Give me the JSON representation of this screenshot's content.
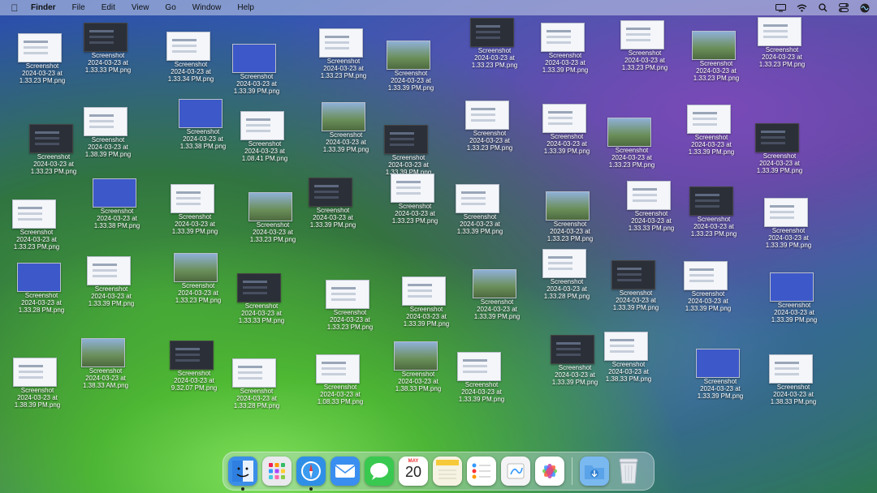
{
  "menubar": {
    "app_name": "Finder",
    "menus": [
      "File",
      "Edit",
      "View",
      "Go",
      "Window",
      "Help"
    ],
    "status_icons": [
      "display-icon",
      "wifi-icon",
      "search-icon",
      "control-center-icon",
      "siri-icon"
    ]
  },
  "desktop": {
    "files": [
      {
        "l1": "Screenshot",
        "l2": "2024-03-23 at",
        "l3": "1.33.23 PM.png"
      },
      {
        "l1": "Screenshot",
        "l2": "2024-03-23 at",
        "l3": "1.33.33 PM.png"
      },
      {
        "l1": "Screenshot",
        "l2": "2024-03-23 at",
        "l3": "1.33.34 PM.png"
      },
      {
        "l1": "Screenshot",
        "l2": "2024-03-23 at",
        "l3": "1.33.39 PM.png"
      },
      {
        "l1": "Screenshot",
        "l2": "2024-03-23 at",
        "l3": "1.33.23 PM.png"
      },
      {
        "l1": "Screenshot",
        "l2": "2024-03-23 at",
        "l3": "1.33.39 PM.png"
      },
      {
        "l1": "Screenshot",
        "l2": "2024-03-23 at",
        "l3": "1.33.23 PM.png"
      },
      {
        "l1": "Screenshot",
        "l2": "2024-03-23 at",
        "l3": "1.33.39 PM.png"
      },
      {
        "l1": "Screenshot",
        "l2": "2024-03-23 at",
        "l3": "1.33.23 PM.png"
      },
      {
        "l1": "Screenshot",
        "l2": "2024-03-23 at",
        "l3": "1.33.23 PM.png"
      },
      {
        "l1": "Screenshot",
        "l2": "2024-03-23 at",
        "l3": "1.33.23 PM.png"
      },
      {
        "l1": "Screenshot",
        "l2": "2024-03-23 at",
        "l3": "1.33.23 PM.png"
      },
      {
        "l1": "Screenshot",
        "l2": "2024-03-23 at",
        "l3": "1.38.39 PM.png"
      },
      {
        "l1": "Screenshot",
        "l2": "2024-03-23 at",
        "l3": "1.33.38 PM.png"
      },
      {
        "l1": "Screenshot",
        "l2": "2024-03-23 at",
        "l3": "1.08.41 PM.png"
      },
      {
        "l1": "Screenshot",
        "l2": "2024-03-23 at",
        "l3": "1.33.39 PM.png"
      },
      {
        "l1": "Screenshot",
        "l2": "2024-03-23 at",
        "l3": "1.33.39 PM.png"
      },
      {
        "l1": "Screenshot",
        "l2": "2024-03-23 at",
        "l3": "1.33.23 PM.png"
      },
      {
        "l1": "Screenshot",
        "l2": "2024-03-23 at",
        "l3": "1.33.39 PM.png"
      },
      {
        "l1": "Screenshot",
        "l2": "2024-03-23 at",
        "l3": "1.33.23 PM.png"
      },
      {
        "l1": "Screenshot",
        "l2": "2024-03-23 at",
        "l3": "1.33.39 PM.png"
      },
      {
        "l1": "Screenshot",
        "l2": "2024-03-23 at",
        "l3": "1.33.39 PM.png"
      },
      {
        "l1": "Screenshot",
        "l2": "2024-03-23 at",
        "l3": "1.33.23 PM.png"
      },
      {
        "l1": "Screenshot",
        "l2": "2024-03-23 at",
        "l3": "1.33.38 PM.png"
      },
      {
        "l1": "Screenshot",
        "l2": "2024-03-23 at",
        "l3": "1.33.39 PM.png"
      },
      {
        "l1": "Screenshot",
        "l2": "2024-03-23 at",
        "l3": "1.33.23 PM.png"
      },
      {
        "l1": "Screenshot",
        "l2": "2024-03-23 at",
        "l3": "1.33.39 PM.png"
      },
      {
        "l1": "Screenshot",
        "l2": "2024-03-23 at",
        "l3": "1.33.23 PM.png"
      },
      {
        "l1": "Screenshot",
        "l2": "2024-03-23 at",
        "l3": "1.33.39 PM.png"
      },
      {
        "l1": "Screenshot",
        "l2": "2024-03-23 at",
        "l3": "1.33.23 PM.png"
      },
      {
        "l1": "Screenshot",
        "l2": "2024-03-23 at",
        "l3": "1.33.33 PM.png"
      },
      {
        "l1": "Screenshot",
        "l2": "2024-03-23 at",
        "l3": "1.33.23 PM.png"
      },
      {
        "l1": "Screenshot",
        "l2": "2024-03-23 at",
        "l3": "1.33.39 PM.png"
      },
      {
        "l1": "Screenshot",
        "l2": "2024-03-23 at",
        "l3": "1.33.28 PM.png"
      },
      {
        "l1": "Screenshot",
        "l2": "2024-03-23 at",
        "l3": "1.33.39 PM.png"
      },
      {
        "l1": "Screenshot",
        "l2": "2024-03-23 at",
        "l3": "1.33.23 PM.png"
      },
      {
        "l1": "Screenshot",
        "l2": "2024-03-23 at",
        "l3": "1.33.33 PM.png"
      },
      {
        "l1": "Screenshot",
        "l2": "2024-03-23 at",
        "l3": "1.33.23 PM.png"
      },
      {
        "l1": "Screenshot",
        "l2": "2024-03-23 at",
        "l3": "1.33.39 PM.png"
      },
      {
        "l1": "Screenshot",
        "l2": "2024-03-23 at",
        "l3": "1.33.39 PM.png"
      },
      {
        "l1": "Screenshot",
        "l2": "2024-03-23 at",
        "l3": "1.33.28 PM.png"
      },
      {
        "l1": "Screenshot",
        "l2": "2024-03-23 at",
        "l3": "1.33.39 PM.png"
      },
      {
        "l1": "Screenshot",
        "l2": "2024-03-23 at",
        "l3": "1.33.39 PM.png"
      },
      {
        "l1": "Screenshot",
        "l2": "2024-03-23 at",
        "l3": "1.33.39 PM.png"
      },
      {
        "l1": "Screenshot",
        "l2": "2024-03-23 at",
        "l3": "1.38.39 PM.png"
      },
      {
        "l1": "Screenshot",
        "l2": "2024-03-23 at",
        "l3": "1.38.33 AM.png"
      },
      {
        "l1": "Screenshot",
        "l2": "2024-03-23 at",
        "l3": "9.32.07 PM.png"
      },
      {
        "l1": "Screenshot",
        "l2": "2024-03-23 at",
        "l3": "1.33.28 PM.png"
      },
      {
        "l1": "Screenshot",
        "l2": "2024-03-23 at",
        "l3": "1.08.33 PM.png"
      },
      {
        "l1": "Screenshot",
        "l2": "2024-03-23 at",
        "l3": "1.38.33 PM.png"
      },
      {
        "l1": "Screenshot",
        "l2": "2024-03-23 at",
        "l3": "1.33.39 PM.png"
      },
      {
        "l1": "Screenshot",
        "l2": "2024-03-23 at",
        "l3": "1.33.39 PM.png"
      },
      {
        "l1": "Screenshot",
        "l2": "2024-03-23 at",
        "l3": "1.38.33 PM.png"
      },
      {
        "l1": "Screenshot",
        "l2": "2024-03-23 at",
        "l3": "1.33.39 PM.png"
      },
      {
        "l1": "Screenshot",
        "l2": "2024-03-23 at",
        "l3": "1.38.33 PM.png"
      }
    ]
  },
  "dock": {
    "apps": [
      {
        "name": "finder-icon",
        "color": "#3b8ee8",
        "running": true
      },
      {
        "name": "launchpad-icon",
        "color": "#e9e9ee",
        "running": false
      },
      {
        "name": "safari-icon",
        "color": "#2f8fe6",
        "running": true
      },
      {
        "name": "mail-icon",
        "color": "#3a8ef0",
        "running": false
      },
      {
        "name": "messages-icon",
        "color": "#39c950",
        "running": false
      },
      {
        "name": "calendar-icon",
        "color": "#ffffff",
        "running": false
      },
      {
        "name": "notes-icon",
        "color": "#f7f3e2",
        "running": false
      },
      {
        "name": "reminders-icon",
        "color": "#ffffff",
        "running": false
      },
      {
        "name": "freeform-icon",
        "color": "#f4f4f6",
        "running": false
      },
      {
        "name": "photos-icon",
        "color": "#ffffff",
        "running": false
      }
    ],
    "calendar": {
      "month": "MAY",
      "day": "20"
    },
    "downloads_color": "#7ab8f0",
    "trash_color": "#e6e9ee"
  }
}
